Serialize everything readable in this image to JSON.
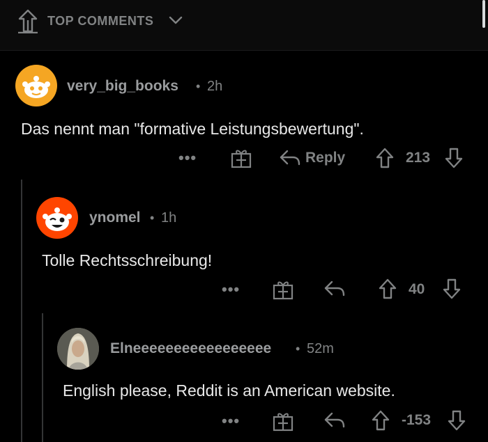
{
  "header": {
    "sort_label": "TOP COMMENTS",
    "sort_icon": "sort-top-icon",
    "dropdown_icon": "chevron-down-icon"
  },
  "comments": [
    {
      "username": "very_big_books",
      "separator": "•",
      "time": "2h",
      "text": "Das nennt man \"formative Leistungsbewertung\".",
      "more_label": "•••",
      "reply_label": "Reply",
      "score": "213",
      "avatar": "snoo-avatar-yellow"
    },
    {
      "username": "ynomel",
      "separator": "•",
      "time": "1h",
      "text": "Tolle Rechtsschreibung!",
      "more_label": "•••",
      "score": "40",
      "avatar": "snoo-avatar-red"
    },
    {
      "username": "Elneeeeeeeeeeeeeeeee",
      "separator": "•",
      "time": "52m",
      "text": "English please, Reddit is an American website.",
      "more_label": "•••",
      "score": "-153",
      "avatar": "photo-avatar"
    }
  ],
  "colors": {
    "background": "#000000",
    "text": "#e8e8e8",
    "muted": "#818384",
    "thread_line": "#343536",
    "snoo_yellow": "#f5a623",
    "snoo_red": "#ff4500"
  }
}
